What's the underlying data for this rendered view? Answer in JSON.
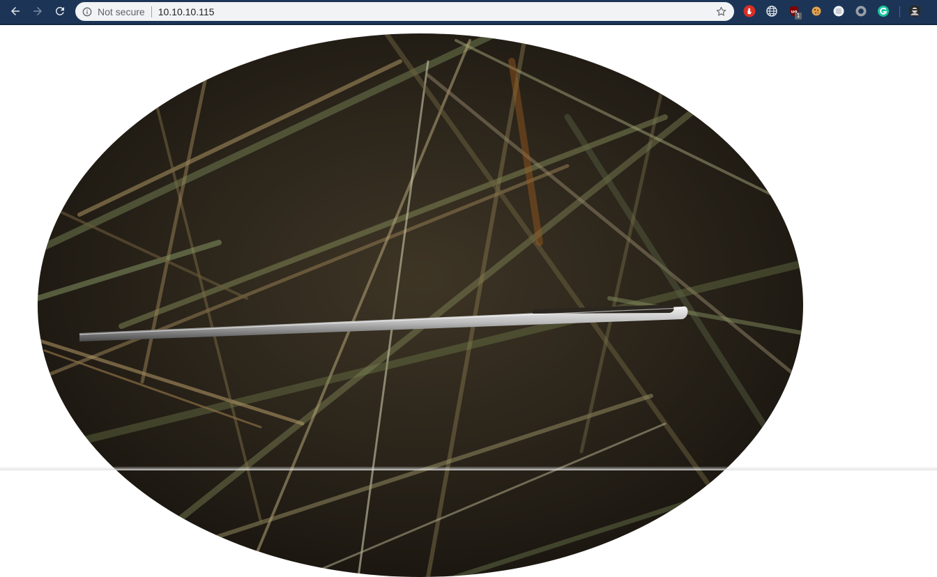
{
  "browser": {
    "address_bar": {
      "security_label": "Not secure",
      "url": "10.10.10.115"
    },
    "nav_icons": [
      "back-arrow-icon",
      "forward-arrow-icon",
      "reload-icon"
    ],
    "extension_badge": "1"
  },
  "colors": {
    "toolbar": "#1c3557",
    "omnibox": "#f1f3f4",
    "page_background": "#ffffff"
  },
  "page": {
    "image_subject": "needle in haystack"
  }
}
